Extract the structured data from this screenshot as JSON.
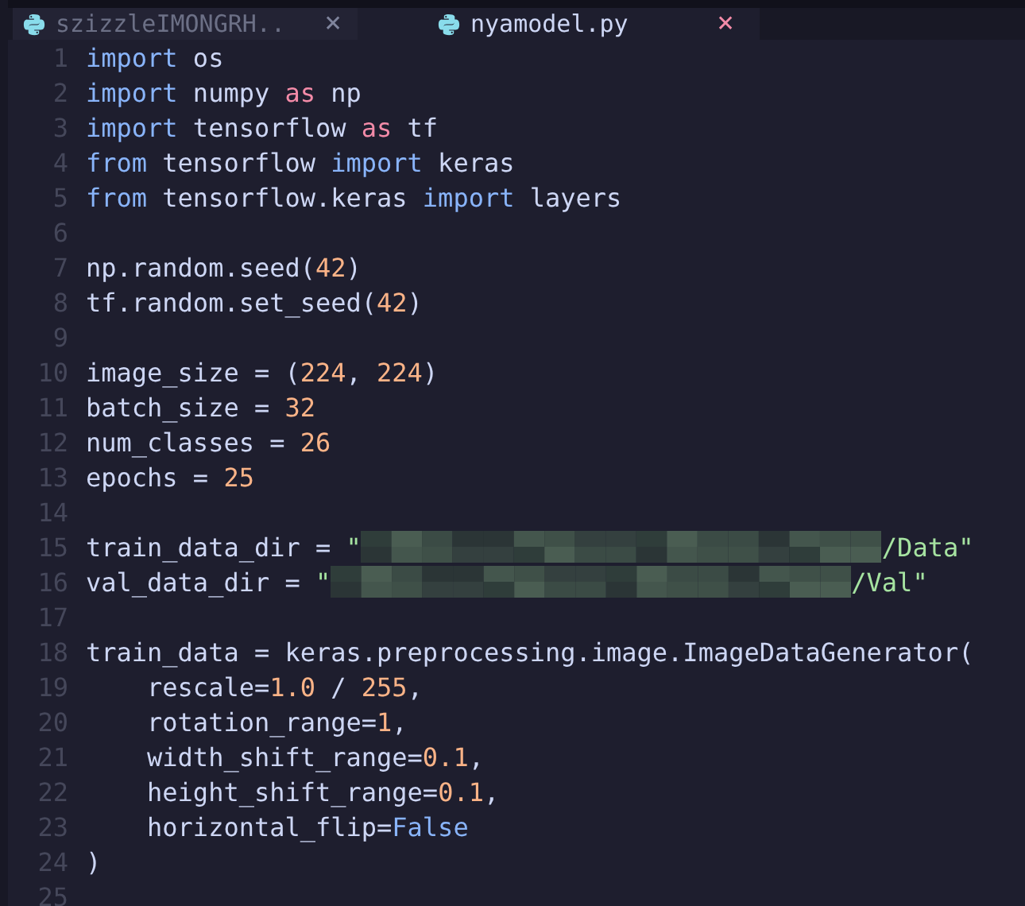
{
  "tabs": [
    {
      "label": "szizzleIMONGRH..",
      "close": "×",
      "selected": false
    },
    {
      "label": "nyamodel.py",
      "close": "×",
      "selected": true
    }
  ],
  "editor": {
    "lines": [
      {
        "number": "1",
        "tokens": [
          {
            "kind": "keyword",
            "text": "import"
          },
          {
            "kind": "plain",
            "text": " os"
          }
        ]
      },
      {
        "number": "2",
        "tokens": [
          {
            "kind": "keyword",
            "text": "import"
          },
          {
            "kind": "plain",
            "text": " numpy "
          },
          {
            "kind": "alias",
            "text": "as"
          },
          {
            "kind": "plain",
            "text": " np"
          }
        ]
      },
      {
        "number": "3",
        "tokens": [
          {
            "kind": "keyword",
            "text": "import"
          },
          {
            "kind": "plain",
            "text": " tensorflow "
          },
          {
            "kind": "alias",
            "text": "as"
          },
          {
            "kind": "plain",
            "text": " tf"
          }
        ]
      },
      {
        "number": "4",
        "tokens": [
          {
            "kind": "keyword",
            "text": "from"
          },
          {
            "kind": "plain",
            "text": " tensorflow "
          },
          {
            "kind": "keyword",
            "text": "import"
          },
          {
            "kind": "plain",
            "text": " keras"
          }
        ]
      },
      {
        "number": "5",
        "tokens": [
          {
            "kind": "keyword",
            "text": "from"
          },
          {
            "kind": "plain",
            "text": " tensorflow.keras "
          },
          {
            "kind": "keyword",
            "text": "import"
          },
          {
            "kind": "plain",
            "text": " layers"
          }
        ]
      },
      {
        "number": "6"
      },
      {
        "number": "7",
        "tokens": [
          {
            "kind": "plain",
            "text": "np.random.seed("
          },
          {
            "kind": "number",
            "text": "42"
          },
          {
            "kind": "plain",
            "text": ")"
          }
        ]
      },
      {
        "number": "8",
        "tokens": [
          {
            "kind": "plain",
            "text": "tf.random.set_seed("
          },
          {
            "kind": "number",
            "text": "42"
          },
          {
            "kind": "plain",
            "text": ")"
          }
        ]
      },
      {
        "number": "9"
      },
      {
        "number": "10",
        "tokens": [
          {
            "kind": "plain",
            "text": "image_size = ("
          },
          {
            "kind": "number",
            "text": "224"
          },
          {
            "kind": "plain",
            "text": ", "
          },
          {
            "kind": "number",
            "text": "224"
          },
          {
            "kind": "plain",
            "text": ")"
          }
        ]
      },
      {
        "number": "11",
        "tokens": [
          {
            "kind": "plain",
            "text": "batch_size = "
          },
          {
            "kind": "number",
            "text": "32"
          }
        ]
      },
      {
        "number": "12",
        "tokens": [
          {
            "kind": "plain",
            "text": "num_classes = "
          },
          {
            "kind": "number",
            "text": "26"
          }
        ]
      },
      {
        "number": "13",
        "tokens": [
          {
            "kind": "plain",
            "text": "epochs = "
          },
          {
            "kind": "number",
            "text": "25"
          }
        ]
      },
      {
        "number": "14"
      },
      {
        "number": "15",
        "tokens": [
          {
            "kind": "plain",
            "text": "train_data_dir = "
          },
          {
            "kind": "string",
            "text": "\""
          },
          {
            "kind": "redacted"
          },
          {
            "kind": "string",
            "text": "/Data\""
          }
        ]
      },
      {
        "number": "16",
        "tokens": [
          {
            "kind": "plain",
            "text": "val_data_dir = "
          },
          {
            "kind": "string",
            "text": "\""
          },
          {
            "kind": "redacted"
          },
          {
            "kind": "string",
            "text": "/Val\""
          }
        ]
      },
      {
        "number": "17"
      },
      {
        "number": "18",
        "tokens": [
          {
            "kind": "plain",
            "text": "train_data = keras.preprocessing.image.ImageDataGenerator("
          }
        ]
      },
      {
        "number": "19",
        "tokens": [
          {
            "kind": "plain",
            "text": "    rescale="
          },
          {
            "kind": "number",
            "text": "1.0"
          },
          {
            "kind": "plain",
            "text": " / "
          },
          {
            "kind": "number",
            "text": "255"
          },
          {
            "kind": "plain",
            "text": ","
          }
        ]
      },
      {
        "number": "20",
        "tokens": [
          {
            "kind": "plain",
            "text": "    rotation_range="
          },
          {
            "kind": "number",
            "text": "1"
          },
          {
            "kind": "plain",
            "text": ","
          }
        ]
      },
      {
        "number": "21",
        "tokens": [
          {
            "kind": "plain",
            "text": "    width_shift_range="
          },
          {
            "kind": "number",
            "text": "0.1"
          },
          {
            "kind": "plain",
            "text": ","
          }
        ]
      },
      {
        "number": "22",
        "tokens": [
          {
            "kind": "plain",
            "text": "    height_shift_range="
          },
          {
            "kind": "number",
            "text": "0.1"
          },
          {
            "kind": "plain",
            "text": ","
          }
        ]
      },
      {
        "number": "23",
        "tokens": [
          {
            "kind": "plain",
            "text": "    horizontal_flip="
          },
          {
            "kind": "constant",
            "text": "False"
          }
        ]
      },
      {
        "number": "24",
        "tokens": [
          {
            "kind": "plain",
            "text": ")"
          }
        ]
      },
      {
        "number": "25"
      }
    ]
  }
}
